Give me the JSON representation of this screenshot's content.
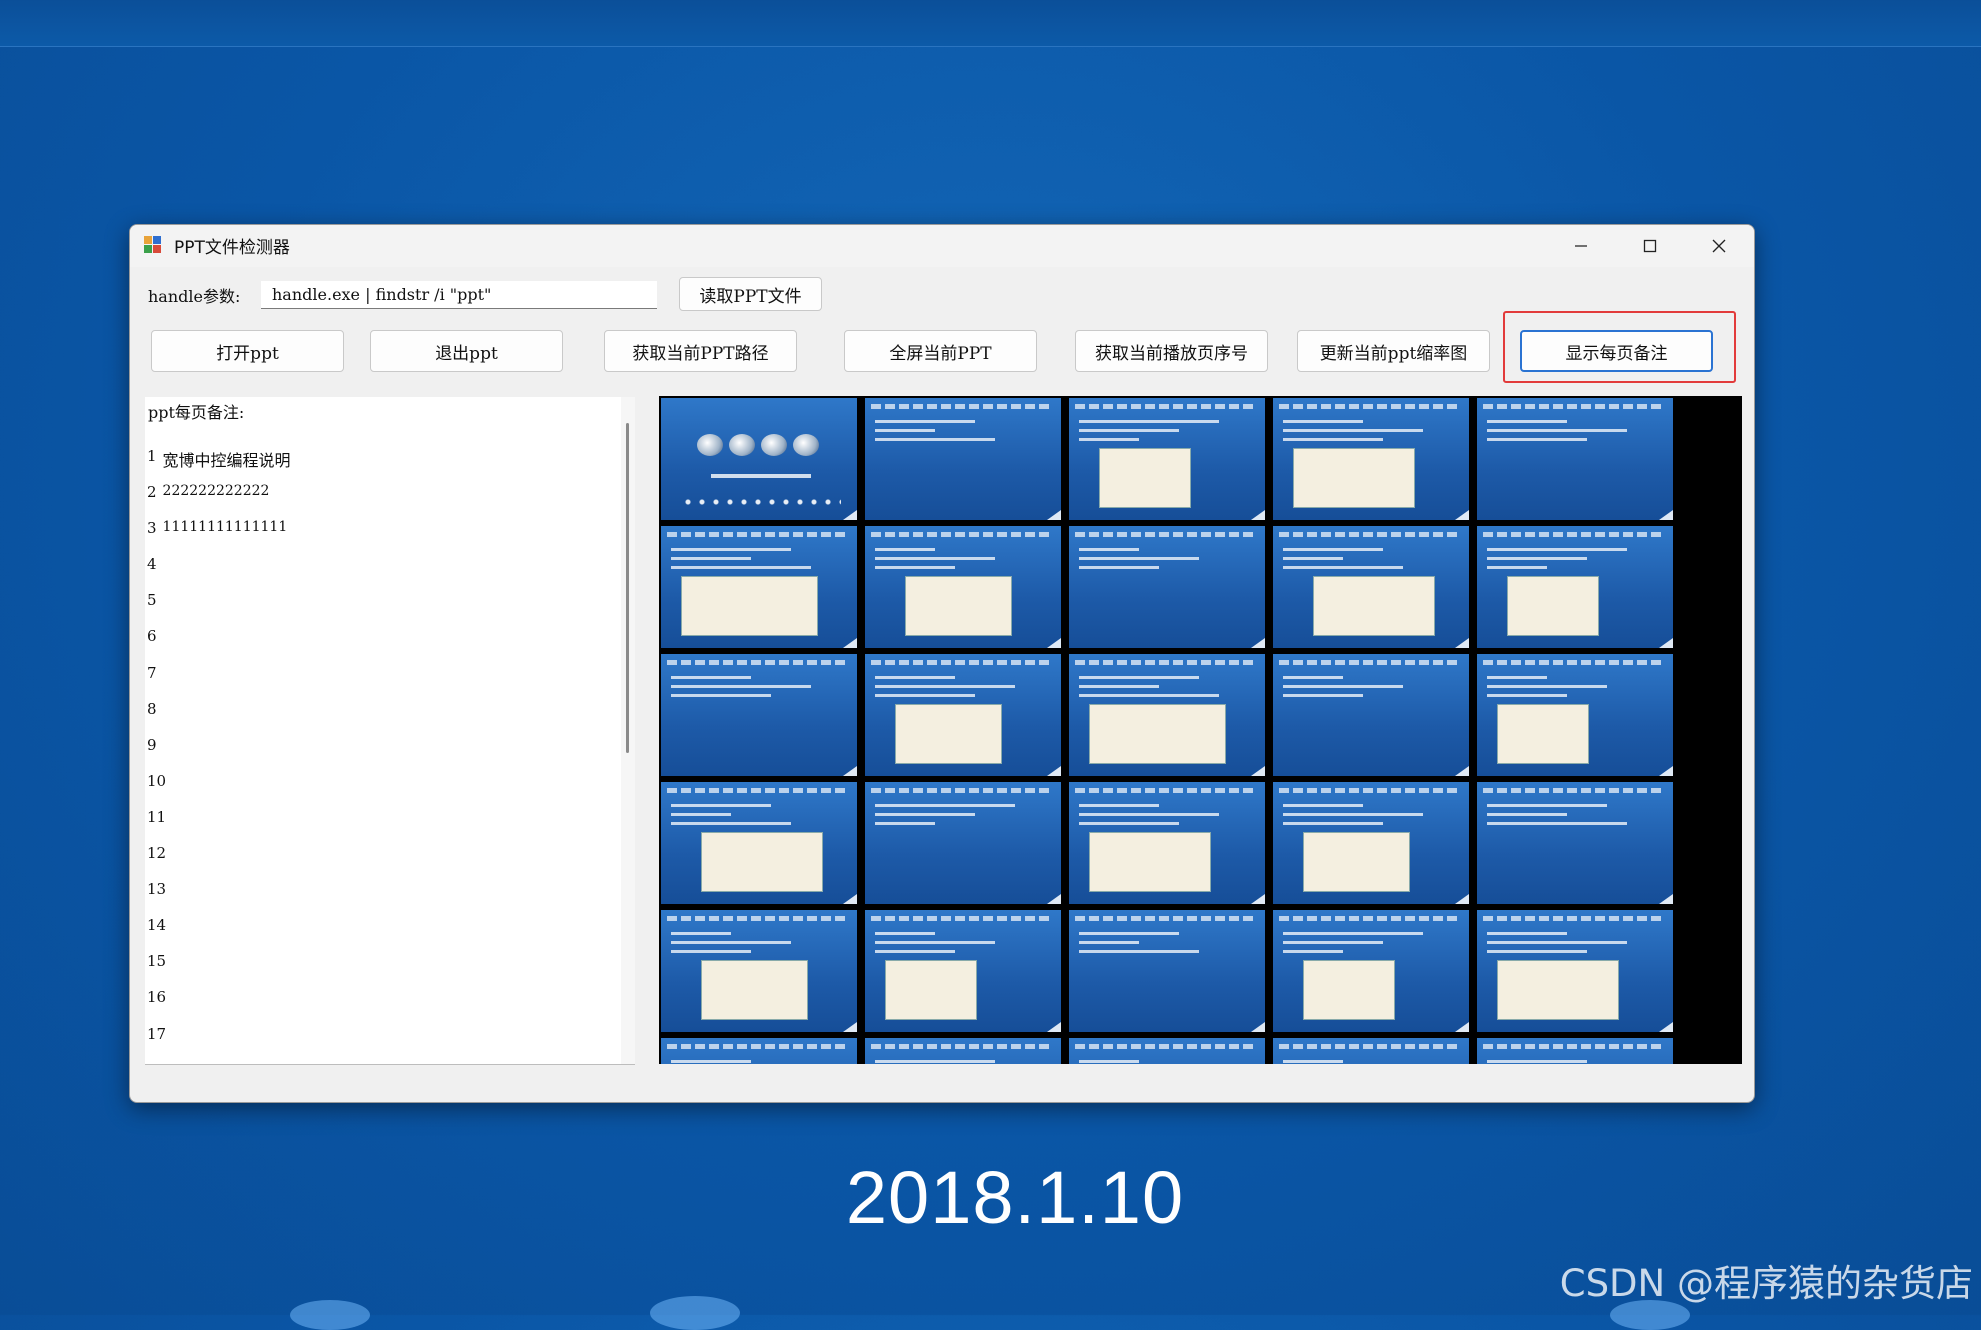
{
  "window": {
    "title": "PPT文件检测器",
    "minimize_icon": "minimize-icon",
    "maximize_icon": "maximize-icon",
    "close_icon": "close-icon"
  },
  "toolbar": {
    "handle_label": "handle参数:",
    "handle_value": "handle.exe | findstr /i \"ppt\"",
    "read_button": "读取PPT文件",
    "buttons": [
      "打开ppt",
      "退出ppt",
      "获取当前PPT路径",
      "全屏当前PPT",
      "获取当前播放页序号",
      "更新当前ppt缩率图",
      "显示每页备注"
    ]
  },
  "notes": {
    "header": "ppt每页备注:",
    "rows": [
      {
        "num": "1",
        "text": "宽博中控编程说明"
      },
      {
        "num": "2",
        "text": "222222222222"
      },
      {
        "num": "3",
        "text": "11111111111111"
      },
      {
        "num": "4",
        "text": ""
      },
      {
        "num": "5",
        "text": ""
      },
      {
        "num": "6",
        "text": ""
      },
      {
        "num": "7",
        "text": ""
      },
      {
        "num": "8",
        "text": ""
      },
      {
        "num": "9",
        "text": ""
      },
      {
        "num": "10",
        "text": ""
      },
      {
        "num": "11",
        "text": ""
      },
      {
        "num": "12",
        "text": ""
      },
      {
        "num": "13",
        "text": ""
      },
      {
        "num": "14",
        "text": ""
      },
      {
        "num": "15",
        "text": ""
      },
      {
        "num": "16",
        "text": ""
      },
      {
        "num": "17",
        "text": ""
      }
    ]
  },
  "thumbnails": {
    "columns": 5,
    "rows_visible": 6
  },
  "background": {
    "date": "2018.1.10",
    "watermark": "CSDN @程序猿的杂货店"
  },
  "colors": {
    "accent": "#2a73d2",
    "highlight": "#e23b3b",
    "desktop": "#0a56a6"
  }
}
